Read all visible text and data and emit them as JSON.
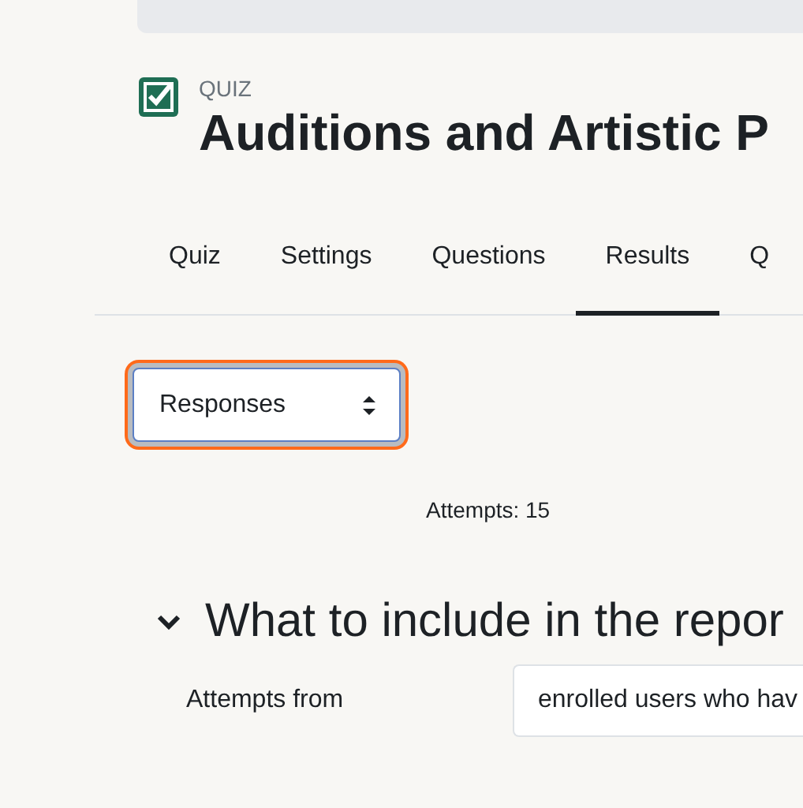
{
  "header": {
    "kind_label": "QUIZ",
    "title": "Auditions and Artistic P"
  },
  "tabs": [
    {
      "label": "Quiz",
      "selected": false
    },
    {
      "label": "Settings",
      "selected": false
    },
    {
      "label": "Questions",
      "selected": false
    },
    {
      "label": "Results",
      "selected": true
    },
    {
      "label": "Q",
      "selected": false
    }
  ],
  "report_select": {
    "value": "Responses",
    "focused": true
  },
  "attempts": "Attempts: 15",
  "section": {
    "heading": "What to include in the repor",
    "expanded": true,
    "fields": [
      {
        "label": "Attempts from",
        "value": "enrolled users who hav"
      }
    ]
  }
}
